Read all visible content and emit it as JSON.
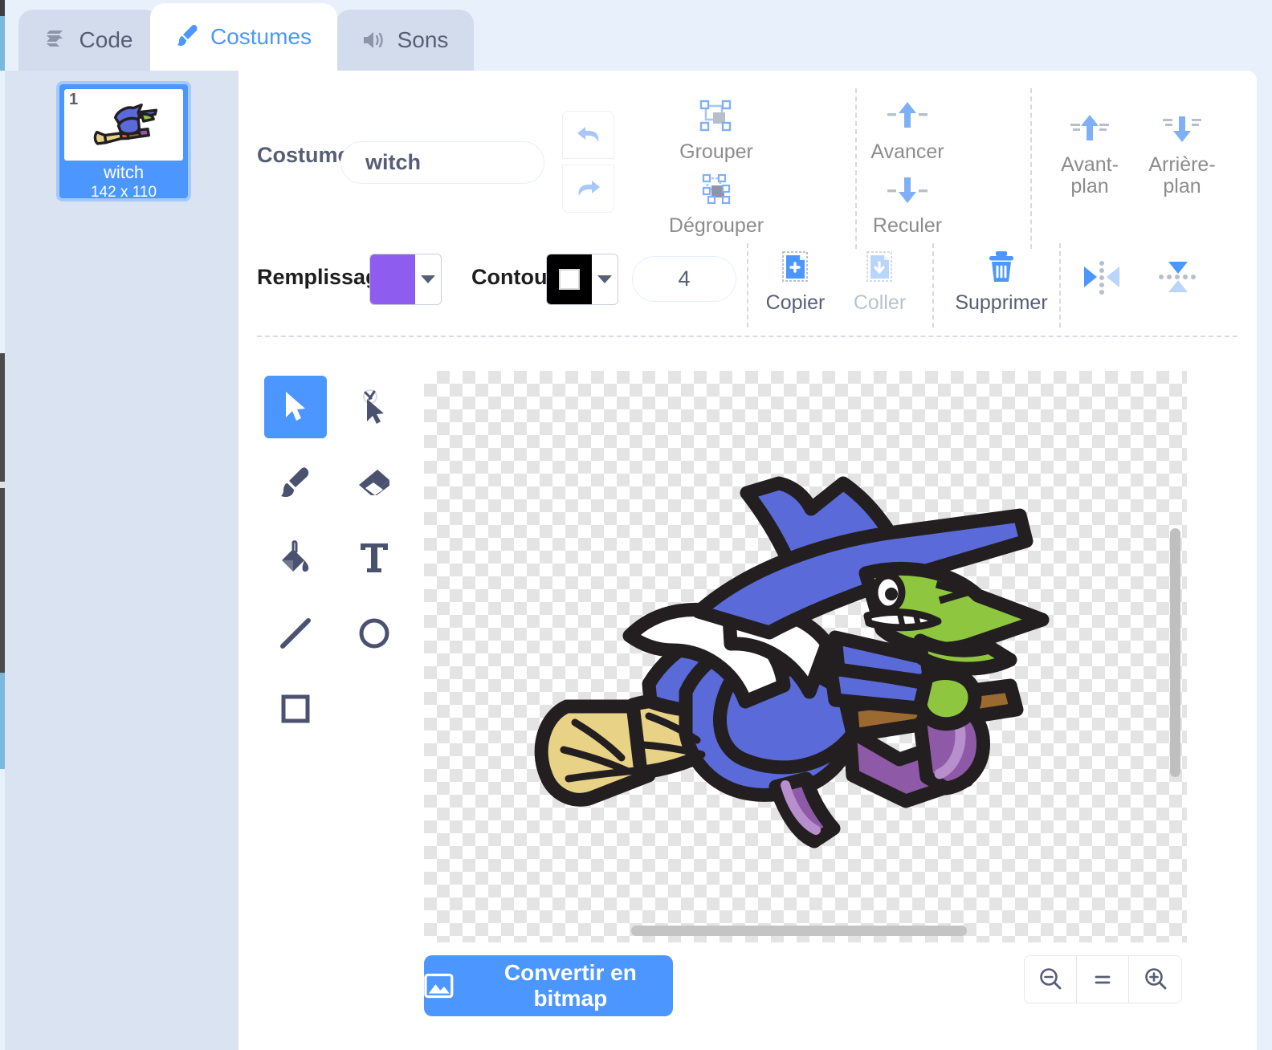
{
  "app": {
    "background_color": "#e8f0fb",
    "accent_color": "#4c97ff",
    "text_color": "#575e75"
  },
  "tabs": [
    {
      "label": "Code",
      "icon": "code-blocks-icon",
      "active": false
    },
    {
      "label": "Costumes",
      "icon": "paintbrush-icon",
      "active": true
    },
    {
      "label": "Sons",
      "icon": "speaker-icon",
      "active": false
    }
  ],
  "sidebar": {
    "costumes": [
      {
        "index": "1",
        "name": "witch",
        "size": "142 x 110",
        "selected": true
      }
    ]
  },
  "toolbar": {
    "costume_label": "Costume",
    "costume_name_value": "witch",
    "costume_name_placeholder": "Costume",
    "undo_icon": "undo-arrow-icon",
    "redo_icon": "redo-arrow-icon",
    "group_label": "Grouper",
    "ungroup_label": "Dégrouper",
    "forward_label": "Avancer",
    "backward_label": "Reculer",
    "front_label": "Avant-plan",
    "back_label": "Arrière-plan",
    "fill_label": "Remplissage",
    "fill_color": "#8f5cf0",
    "stroke_label": "Contour",
    "stroke_color": "#000000",
    "stroke_width_value": "4",
    "copy_label": "Copier",
    "paste_label": "Coller",
    "paste_disabled": true,
    "delete_label": "Supprimer",
    "flip_horizontal_icon": "flip-horizontal-icon",
    "flip_vertical_icon": "flip-vertical-icon"
  },
  "tools": [
    {
      "name": "select",
      "icon": "arrow-cursor-icon",
      "active": true
    },
    {
      "name": "reshape",
      "icon": "reshape-node-icon",
      "active": false
    },
    {
      "name": "brush",
      "icon": "paintbrush-icon",
      "active": false
    },
    {
      "name": "eraser",
      "icon": "eraser-icon",
      "active": false
    },
    {
      "name": "fill",
      "icon": "paint-bucket-icon",
      "active": false
    },
    {
      "name": "text",
      "icon": "text-t-icon",
      "active": false
    },
    {
      "name": "line",
      "icon": "line-icon",
      "active": false
    },
    {
      "name": "circle",
      "icon": "circle-icon",
      "active": false
    },
    {
      "name": "rectangle",
      "icon": "square-icon",
      "active": false
    }
  ],
  "canvas": {
    "artwork": "witch-flying-on-broom",
    "colors": {
      "robe_blue": "#5a6ad8",
      "skin_green": "#8ec63f",
      "outline_black": "#231f20",
      "hair_white": "#ffffff",
      "broom_tan": "#e8d285",
      "broom_brown": "#9b6a30",
      "broom_band_orange": "#e8603c",
      "shoe_purple": "#8e5aa8",
      "shoe_light_purple": "#b68fcc"
    }
  },
  "bottom": {
    "convert_label": "Convertir en bitmap",
    "convert_icon": "image-icon",
    "zoom_out_icon": "zoom-out-icon",
    "zoom_reset_label": "=",
    "zoom_in_icon": "zoom-in-icon"
  }
}
